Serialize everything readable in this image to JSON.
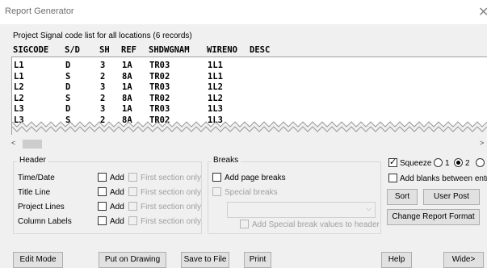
{
  "window": {
    "title": "Report Generator",
    "close_glyph": "✕"
  },
  "report": {
    "subtitle": "Project Signal code list for all locations (6 records)",
    "columns": [
      "SIGCODE",
      "S/D",
      "SH",
      "REF",
      "SHDWGNAM",
      "WIRENO",
      "DESC"
    ],
    "rows": [
      [
        "L1",
        "D",
        "3",
        "1A",
        "TR03",
        "1L1",
        ""
      ],
      [
        "L1",
        "S",
        "2",
        "8A",
        "TR02",
        "1L1",
        ""
      ],
      [
        "L2",
        "D",
        "3",
        "1A",
        "TR03",
        "1L2",
        ""
      ],
      [
        "L2",
        "S",
        "2",
        "8A",
        "TR02",
        "1L2",
        ""
      ],
      [
        "L3",
        "D",
        "3",
        "1A",
        "TR03",
        "1L3",
        ""
      ],
      [
        "L3",
        "S",
        "2",
        "8A",
        "TR02",
        "1L3",
        ""
      ]
    ]
  },
  "scrollbar": {
    "left_glyph": "<",
    "right_glyph": ">"
  },
  "header_group": {
    "label": "Header",
    "rows": [
      {
        "label": "Time/Date",
        "add": "Add",
        "first": "First section only"
      },
      {
        "label": "Title Line",
        "add": "Add",
        "first": "First section only"
      },
      {
        "label": "Project Lines",
        "add": "Add",
        "first": "First section only"
      },
      {
        "label": "Column Labels",
        "add": "Add",
        "first": "First section only"
      }
    ]
  },
  "breaks_group": {
    "label": "Breaks",
    "add_page_breaks": "Add page breaks",
    "special_breaks": "Special breaks",
    "add_special_values": "Add Special break values to header",
    "combo_value": ""
  },
  "options": {
    "squeeze": {
      "label": "Squeeze",
      "checked": true
    },
    "squeeze_levels": [
      {
        "label": "1",
        "selected": false
      },
      {
        "label": "2",
        "selected": true
      },
      {
        "label": "",
        "selected": false
      }
    ],
    "add_blanks": "Add blanks between entrie",
    "sort": "Sort",
    "user_post": "User Post",
    "change_format": "Change Report Format"
  },
  "bottom_buttons": {
    "edit_mode": "Edit Mode",
    "put_on_drawing": "Put on Drawing",
    "save_to_file": "Save to File",
    "print": "Print",
    "help": "Help",
    "wide": "Wide>"
  },
  "colors": {
    "window_bg": "#f0f0f0",
    "text_area_bg": "#ffffff",
    "button_bg": "#e1e1e1",
    "disabled_text": "#a0a0a0"
  }
}
